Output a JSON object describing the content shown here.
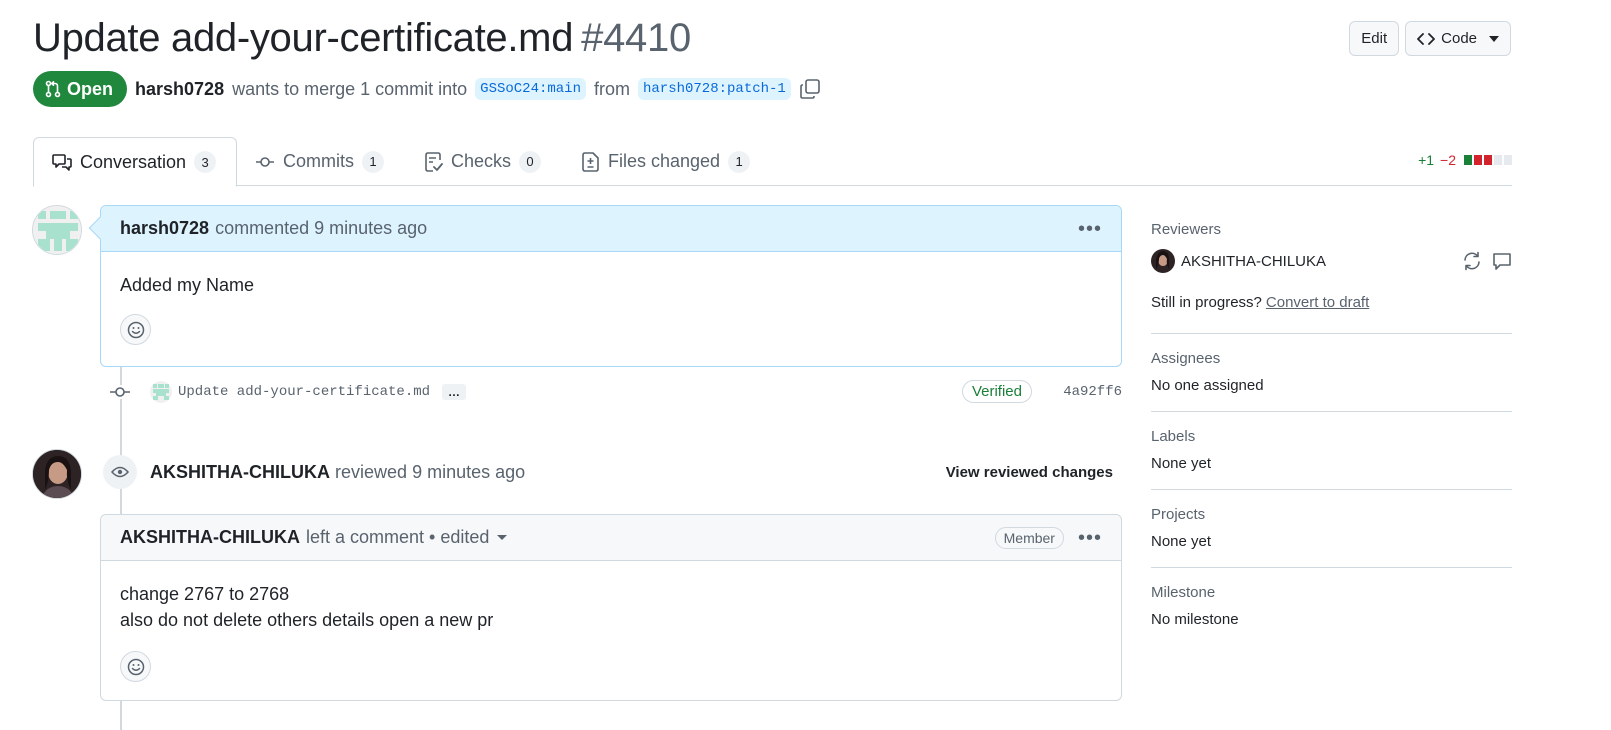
{
  "header": {
    "title": "Update add-your-certificate.md",
    "number": "#4410",
    "edit_label": "Edit",
    "code_label": "Code"
  },
  "status": {
    "state": "Open",
    "author": "harsh0728",
    "summary": "wants to merge 1 commit into",
    "base_branch": "GSSoC24:main",
    "from_text": "from",
    "head_branch": "harsh0728:patch-1"
  },
  "tabs": [
    {
      "label": "Conversation",
      "count": "3"
    },
    {
      "label": "Commits",
      "count": "1"
    },
    {
      "label": "Checks",
      "count": "0"
    },
    {
      "label": "Files changed",
      "count": "1"
    }
  ],
  "diffstat": {
    "additions": "+1",
    "deletions": "−2"
  },
  "timeline": {
    "first_comment": {
      "author": "harsh0728",
      "action": "commented",
      "time": "9 minutes ago",
      "body": "Added my Name"
    },
    "commit": {
      "message": "Update add-your-certificate.md",
      "ellipsis": "…",
      "verified": "Verified",
      "sha": "4a92ff6"
    },
    "review": {
      "author": "AKSHITHA-CHILUKA",
      "action": "reviewed",
      "time": "9 minutes ago",
      "view_label": "View reviewed changes"
    },
    "review_comment": {
      "author": "AKSHITHA-CHILUKA",
      "action": "left a comment • edited",
      "role": "Member",
      "line1": "change 2767 to 2768",
      "line2": "also do not delete others details open a new pr"
    }
  },
  "sidebar": {
    "reviewers": {
      "title": "Reviewers",
      "name": "AKSHITHA-CHILUKA",
      "draft_text": "Still in progress?",
      "draft_link": "Convert to draft"
    },
    "assignees": {
      "title": "Assignees",
      "value": "No one assigned"
    },
    "labels": {
      "title": "Labels",
      "value": "None yet"
    },
    "projects": {
      "title": "Projects",
      "value": "None yet"
    },
    "milestone": {
      "title": "Milestone",
      "value": "No milestone"
    }
  },
  "colors": {
    "open_green": "#1f883d",
    "link_blue": "#0969da",
    "own_comment_header": "#ddf4ff",
    "add_green": "#1a7f37",
    "del_red": "#d1242f"
  }
}
